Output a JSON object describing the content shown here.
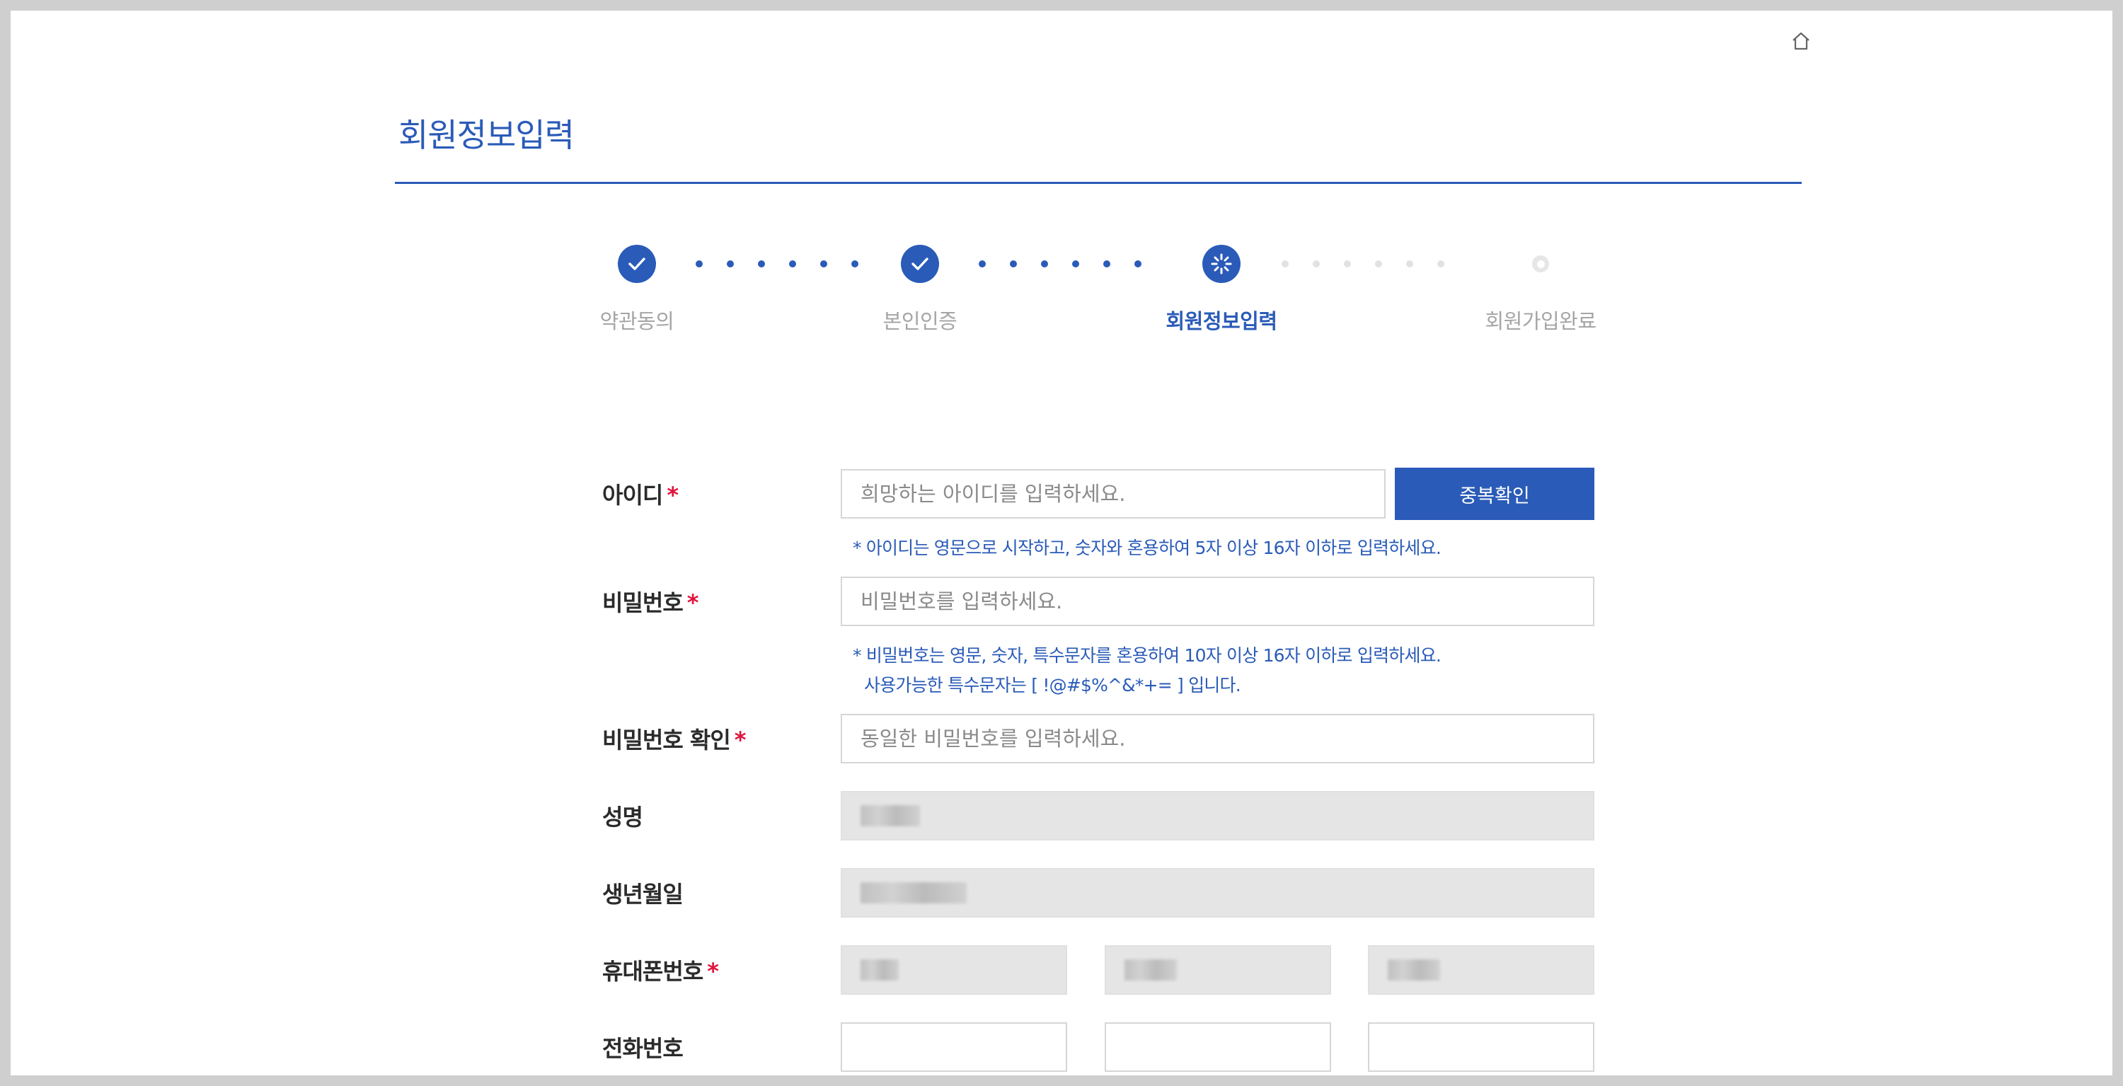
{
  "page": {
    "title": "회원정보입력"
  },
  "stepper": {
    "steps": [
      {
        "label": "약관동의",
        "state": "done"
      },
      {
        "label": "본인인증",
        "state": "done"
      },
      {
        "label": "회원정보입력",
        "state": "current"
      },
      {
        "label": "회원가입완료",
        "state": "pending"
      }
    ]
  },
  "form": {
    "id": {
      "label": "아이디",
      "required_mark": "*",
      "placeholder": "희망하는 아이디를 입력하세요.",
      "button": "중복확인",
      "hint": "* 아이디는 영문으로 시작하고, 숫자와 혼용하여 5자 이상 16자 이하로 입력하세요."
    },
    "password": {
      "label": "비밀번호",
      "required_mark": "*",
      "placeholder": "비밀번호를 입력하세요.",
      "hint_line1": "* 비밀번호는 영문, 숫자, 특수문자를 혼용하여 10자 이상 16자 이하로 입력하세요.",
      "hint_line2": "사용가능한 특수문자는 [ !@#$%^&*+= ] 입니다."
    },
    "password_confirm": {
      "label": "비밀번호 확인",
      "required_mark": "*",
      "placeholder": "동일한 비밀번호를 입력하세요."
    },
    "name": {
      "label": "성명"
    },
    "birthdate": {
      "label": "생년월일"
    },
    "mobile": {
      "label": "휴대폰번호",
      "required_mark": "*"
    },
    "phone": {
      "label": "전화번호"
    }
  },
  "colors": {
    "accent": "#2a5bb8",
    "required": "#e0143c",
    "disabled_bg": "#e5e5e5",
    "border": "#d6d6d6"
  },
  "icons": {
    "home": "home-icon",
    "check": "check-icon",
    "spinner": "loading-icon"
  }
}
